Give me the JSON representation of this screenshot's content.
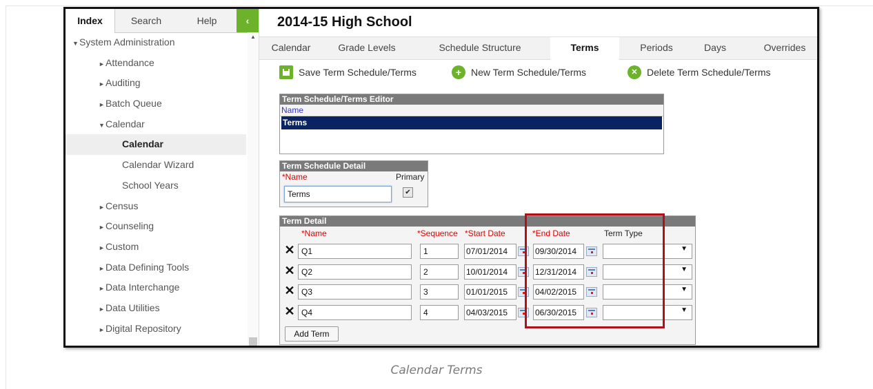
{
  "sidebar": {
    "tabs": [
      "Index",
      "Search",
      "Help"
    ],
    "collapse_glyph": "‹",
    "items": [
      {
        "label": "System Administration",
        "level": 0,
        "arrow": "▼",
        "selected": false
      },
      {
        "label": "Attendance",
        "level": 1,
        "arrow": "►",
        "selected": false
      },
      {
        "label": "Auditing",
        "level": 1,
        "arrow": "►",
        "selected": false
      },
      {
        "label": "Batch Queue",
        "level": 1,
        "arrow": "►",
        "selected": false
      },
      {
        "label": "Calendar",
        "level": 1,
        "arrow": "▼",
        "selected": false
      },
      {
        "label": "Calendar",
        "level": 2,
        "arrow": "",
        "selected": true
      },
      {
        "label": "Calendar Wizard",
        "level": 2,
        "arrow": "",
        "selected": false
      },
      {
        "label": "School Years",
        "level": 2,
        "arrow": "",
        "selected": false
      },
      {
        "label": "Census",
        "level": 1,
        "arrow": "►",
        "selected": false
      },
      {
        "label": "Counseling",
        "level": 1,
        "arrow": "►",
        "selected": false
      },
      {
        "label": "Custom",
        "level": 1,
        "arrow": "►",
        "selected": false
      },
      {
        "label": "Data Defining Tools",
        "level": 1,
        "arrow": "►",
        "selected": false
      },
      {
        "label": "Data Interchange",
        "level": 1,
        "arrow": "►",
        "selected": false
      },
      {
        "label": "Data Utilities",
        "level": 1,
        "arrow": "►",
        "selected": false
      },
      {
        "label": "Digital Repository",
        "level": 1,
        "arrow": "►",
        "selected": false
      }
    ]
  },
  "main": {
    "title": "2014-15 High School",
    "tabs": [
      "Calendar",
      "Grade Levels",
      "Schedule Structure",
      "Terms",
      "Periods",
      "Days",
      "Overrides"
    ],
    "active_tab": "Terms",
    "actions": {
      "save": "Save Term Schedule/Terms",
      "new": "New Term Schedule/Terms",
      "delete": "Delete Term Schedule/Terms",
      "new_glyph": "+",
      "delete_glyph": "✕"
    },
    "editor": {
      "title": "Term Schedule/Terms Editor",
      "column": "Name",
      "rows": [
        "Terms"
      ]
    },
    "detail": {
      "title": "Term Schedule Detail",
      "name_label": "*Name",
      "primary_label": "Primary",
      "name_value": "Terms",
      "primary_checked": "✔"
    },
    "term_detail": {
      "title": "Term Detail",
      "headers": {
        "name": "*Name",
        "sequence": "*Sequence",
        "start": "*Start Date",
        "end": "*End Date",
        "type": "Term Type"
      },
      "delete_glyph": "✕",
      "caret": "▼",
      "rows": [
        {
          "name": "Q1",
          "sequence": "1",
          "start": "07/01/2014",
          "end": "09/30/2014",
          "type": ""
        },
        {
          "name": "Q2",
          "sequence": "2",
          "start": "10/01/2014",
          "end": "12/31/2014",
          "type": ""
        },
        {
          "name": "Q3",
          "sequence": "3",
          "start": "01/01/2015",
          "end": "04/02/2015",
          "type": ""
        },
        {
          "name": "Q4",
          "sequence": "4",
          "start": "04/03/2015",
          "end": "06/30/2015",
          "type": ""
        }
      ],
      "add_button": "Add Term"
    }
  },
  "caption": "Calendar Terms",
  "colors": {
    "accent_green": "#6cb32b",
    "selected_row": "#0a2461",
    "highlight_box": "#b0101a"
  }
}
